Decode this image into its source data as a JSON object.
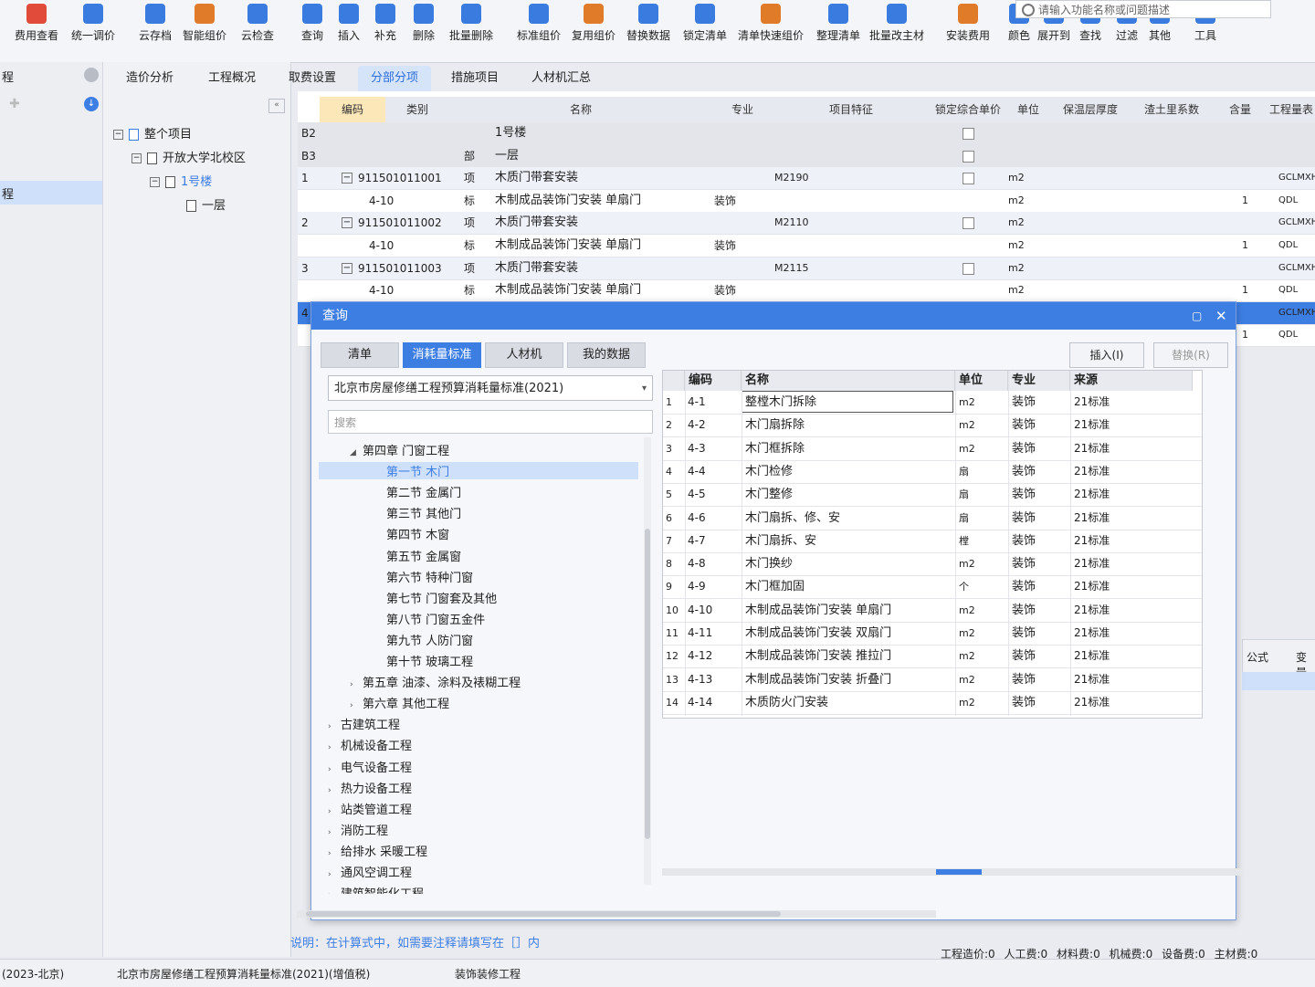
{
  "toolbar": {
    "items": [
      {
        "label": "费用查看",
        "icon": "cost-view-icon",
        "color": "#e04b3a"
      },
      {
        "label": "统一调价",
        "icon": "adjust-price-icon",
        "color": "#3a7be0"
      },
      {
        "label": "云存档",
        "icon": "cloud-save-icon",
        "color": "#3a7be0"
      },
      {
        "label": "智能组价",
        "icon": "smart-price-icon",
        "color": "#e07b2a"
      },
      {
        "label": "云检查",
        "icon": "cloud-check-icon",
        "color": "#3a7be0"
      },
      {
        "label": "查询",
        "icon": "query-icon",
        "color": "#3a7be0"
      },
      {
        "label": "插入",
        "icon": "insert-icon",
        "color": "#3a7be0"
      },
      {
        "label": "补充",
        "icon": "supplement-icon",
        "color": "#3a7be0"
      },
      {
        "label": "删除",
        "icon": "delete-icon",
        "color": "#3a7be0"
      },
      {
        "label": "批量删除",
        "icon": "batch-delete-icon",
        "color": "#3a7be0"
      },
      {
        "label": "标准组价",
        "icon": "standard-price-icon",
        "color": "#3a7be0"
      },
      {
        "label": "复用组价",
        "icon": "reuse-price-icon",
        "color": "#e07b2a"
      },
      {
        "label": "替换数据",
        "icon": "replace-data-icon",
        "color": "#3a7be0"
      },
      {
        "label": "锁定清单",
        "icon": "lock-list-icon",
        "color": "#3a7be0"
      },
      {
        "label": "清单快速组价",
        "icon": "quick-price-icon",
        "color": "#e07b2a"
      },
      {
        "label": "整理清单",
        "icon": "organize-list-icon",
        "color": "#3a7be0"
      },
      {
        "label": "批量改主材",
        "icon": "batch-material-icon",
        "color": "#3a7be0"
      },
      {
        "label": "安装费用",
        "icon": "install-fee-icon",
        "color": "#e07b2a"
      },
      {
        "label": "颜色",
        "icon": "color-icon",
        "color": "#3a7be0"
      },
      {
        "label": "展开到",
        "icon": "expand-to-icon",
        "color": "#3a7be0"
      },
      {
        "label": "查找",
        "icon": "find-icon",
        "color": "#3a7be0"
      },
      {
        "label": "过滤",
        "icon": "filter-icon",
        "color": "#3a7be0"
      },
      {
        "label": "其他",
        "icon": "other-icon",
        "color": "#3a7be0"
      },
      {
        "label": "工具",
        "icon": "tools-icon",
        "color": "#3a7be0"
      }
    ],
    "search_placeholder": "请输入功能名称或问题描述"
  },
  "left_panel": {
    "edge_labels": [
      "程",
      "程"
    ],
    "tree": [
      {
        "label": "整个项目",
        "box": "−"
      },
      {
        "label": "开放大学北校区",
        "box": "−"
      },
      {
        "label": "1号楼",
        "box": "−"
      },
      {
        "label": "一层",
        "box": ""
      }
    ]
  },
  "tabs": [
    "造价分析",
    "工程概况",
    "取费设置",
    "分部分项",
    "措施项目",
    "人材机汇总"
  ],
  "active_tab": "分部分项",
  "grid": {
    "headers": [
      "编码",
      "类别",
      "名称",
      "专业",
      "项目特征",
      "锁定综合单价",
      "单位",
      "保温层厚度",
      "渣土里系数",
      "含量",
      "工程量表"
    ],
    "rows": [
      {
        "num": "B2",
        "code": "",
        "type": "",
        "name": "1号楼",
        "spec": "",
        "feature": "",
        "unit": "",
        "qty": "",
        "expr": ""
      },
      {
        "num": "B3",
        "code": "",
        "type": "部",
        "name": "一层",
        "spec": "",
        "feature": "",
        "unit": "",
        "qty": "",
        "expr": ""
      },
      {
        "num": "1",
        "code": "911501011001",
        "type": "项",
        "name": "木质门带套安装",
        "spec": "",
        "feature": "M2190",
        "unit": "m2",
        "qty": "",
        "expr": "GCLMXHJ"
      },
      {
        "num": "",
        "code": "4-10",
        "type": "标",
        "name": "木制成品装饰门安装 单扇门",
        "spec": "装饰",
        "feature": "",
        "unit": "m2",
        "qty": "1",
        "expr": "QDL"
      },
      {
        "num": "2",
        "code": "911501011002",
        "type": "项",
        "name": "木质门带套安装",
        "spec": "",
        "feature": "M2110",
        "unit": "m2",
        "qty": "",
        "expr": "GCLMXHJ"
      },
      {
        "num": "",
        "code": "4-10",
        "type": "标",
        "name": "木制成品装饰门安装 单扇门",
        "spec": "装饰",
        "feature": "",
        "unit": "m2",
        "qty": "1",
        "expr": "QDL"
      },
      {
        "num": "3",
        "code": "911501011003",
        "type": "项",
        "name": "木质门带套安装",
        "spec": "",
        "feature": "M2115",
        "unit": "m2",
        "qty": "",
        "expr": "GCLMXHJ"
      },
      {
        "num": "",
        "code": "4-10",
        "type": "标",
        "name": "木制成品装饰门安装 单扇门",
        "spec": "装饰",
        "feature": "",
        "unit": "m2",
        "qty": "1",
        "expr": "QDL"
      },
      {
        "num": "4",
        "code": "",
        "type": "",
        "name": "",
        "spec": "",
        "feature": "",
        "unit": "",
        "qty": "",
        "expr": "GCLMXHJ"
      },
      {
        "num": "",
        "code": "",
        "type": "",
        "name": "",
        "spec": "",
        "feature": "",
        "unit": "",
        "qty": "1",
        "expr": "QDL"
      }
    ]
  },
  "dialog": {
    "title": "查询",
    "tabs": [
      "清单",
      "消耗量标准",
      "人材机",
      "我的数据"
    ],
    "active_tab": "消耗量标准",
    "insert_button": "插入(I)",
    "replace_button": "替换(R)",
    "standard_select": "北京市房屋修缮工程预算消耗量标准(2021)",
    "search_placeholder": "搜索",
    "tree": [
      {
        "label": "第四章 门窗工程",
        "level": 1,
        "caret": "open"
      },
      {
        "label": "第一节 木门",
        "level": 2,
        "caret": "",
        "selected": true
      },
      {
        "label": "第二节 金属门",
        "level": 2,
        "caret": ""
      },
      {
        "label": "第三节 其他门",
        "level": 2,
        "caret": ""
      },
      {
        "label": "第四节 木窗",
        "level": 2,
        "caret": ""
      },
      {
        "label": "第五节 金属窗",
        "level": 2,
        "caret": ""
      },
      {
        "label": "第六节 特种门窗",
        "level": 2,
        "caret": ""
      },
      {
        "label": "第七节 门窗套及其他",
        "level": 2,
        "caret": ""
      },
      {
        "label": "第八节 门窗五金件",
        "level": 2,
        "caret": ""
      },
      {
        "label": "第九节 人防门窗",
        "level": 2,
        "caret": ""
      },
      {
        "label": "第十节 玻璃工程",
        "level": 2,
        "caret": ""
      },
      {
        "label": "第五章 油漆、涂料及裱糊工程",
        "level": 1,
        "caret": "closed"
      },
      {
        "label": "第六章 其他工程",
        "level": 1,
        "caret": "closed"
      },
      {
        "label": "古建筑工程",
        "level": 0,
        "caret": "closed"
      },
      {
        "label": "机械设备工程",
        "level": 0,
        "caret": "closed"
      },
      {
        "label": "电气设备工程",
        "level": 0,
        "caret": "closed"
      },
      {
        "label": "热力设备工程",
        "level": 0,
        "caret": "closed"
      },
      {
        "label": "站类管道工程",
        "level": 0,
        "caret": "closed"
      },
      {
        "label": "消防工程",
        "level": 0,
        "caret": "closed"
      },
      {
        "label": "给排水 采暖工程",
        "level": 0,
        "caret": "closed"
      },
      {
        "label": "通风空调工程",
        "level": 0,
        "caret": "closed"
      },
      {
        "label": "建筑智能化工程",
        "level": 0,
        "caret": "closed"
      }
    ],
    "table_headers": [
      "编码",
      "名称",
      "单位",
      "专业",
      "来源"
    ],
    "rows": [
      {
        "n": "1",
        "code": "4-1",
        "name": "整樘木门拆除",
        "unit": "m2",
        "spec": "装饰",
        "src": "21标准"
      },
      {
        "n": "2",
        "code": "4-2",
        "name": "木门扇拆除",
        "unit": "m2",
        "spec": "装饰",
        "src": "21标准"
      },
      {
        "n": "3",
        "code": "4-3",
        "name": "木门框拆除",
        "unit": "m2",
        "spec": "装饰",
        "src": "21标准"
      },
      {
        "n": "4",
        "code": "4-4",
        "name": "木门检修",
        "unit": "扇",
        "spec": "装饰",
        "src": "21标准"
      },
      {
        "n": "5",
        "code": "4-5",
        "name": "木门整修",
        "unit": "扇",
        "spec": "装饰",
        "src": "21标准"
      },
      {
        "n": "6",
        "code": "4-6",
        "name": "木门扇拆、修、安",
        "unit": "扇",
        "spec": "装饰",
        "src": "21标准"
      },
      {
        "n": "7",
        "code": "4-7",
        "name": "木门扇拆、安",
        "unit": "樘",
        "spec": "装饰",
        "src": "21标准"
      },
      {
        "n": "8",
        "code": "4-8",
        "name": "木门换纱",
        "unit": "m2",
        "spec": "装饰",
        "src": "21标准"
      },
      {
        "n": "9",
        "code": "4-9",
        "name": "木门框加固",
        "unit": "个",
        "spec": "装饰",
        "src": "21标准"
      },
      {
        "n": "10",
        "code": "4-10",
        "name": "木制成品装饰门安装 单扇门",
        "unit": "m2",
        "spec": "装饰",
        "src": "21标准"
      },
      {
        "n": "11",
        "code": "4-11",
        "name": "木制成品装饰门安装 双扇门",
        "unit": "m2",
        "spec": "装饰",
        "src": "21标准"
      },
      {
        "n": "12",
        "code": "4-12",
        "name": "木制成品装饰门安装 推拉门",
        "unit": "m2",
        "spec": "装饰",
        "src": "21标准"
      },
      {
        "n": "13",
        "code": "4-13",
        "name": "木制成品装饰门安装 折叠门",
        "unit": "m2",
        "spec": "装饰",
        "src": "21标准"
      },
      {
        "n": "14",
        "code": "4-14",
        "name": "木质防火门安装",
        "unit": "m2",
        "spec": "装饰",
        "src": "21标准"
      }
    ]
  },
  "note": "说明：在计算式中，如需要注释请填写在［］内",
  "side_labels": {
    "formula": "公式",
    "var": "变量"
  },
  "summary": {
    "total": "工程造价:0",
    "labor": "人工费:0",
    "material": "材料费:0",
    "machine": "机械费:0",
    "equipment": "设备费:0",
    "main_material": "主材费:0"
  },
  "statusbar": {
    "left": "(2023-北京)",
    "standard": "北京市房屋修缮工程预算消耗量标准(2021)(增值税)",
    "project_type": "装饰装修工程"
  }
}
